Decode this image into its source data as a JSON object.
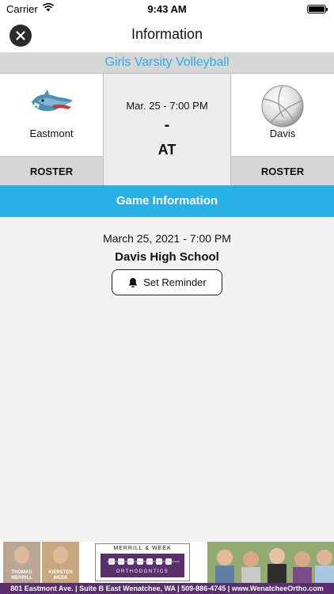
{
  "status_bar": {
    "carrier": "Carrier",
    "time": "9:43 AM"
  },
  "nav": {
    "title": "Information"
  },
  "sport": "Girls Varsity Volleyball",
  "matchup": {
    "home_team": "Eastmont",
    "away_team": "Davis",
    "datetime": "Mar. 25 - 7:00 PM",
    "score": "-",
    "at_label": "AT",
    "roster_label": "ROSTER"
  },
  "game_info": {
    "header": "Game Information",
    "datetime": "March 25, 2021 - 7:00 PM",
    "location": "Davis High School",
    "reminder_label": "Set Reminder"
  },
  "ad": {
    "person1": "THOMAS\nMERRILL",
    "person2": "KIERSTEN\nWEEK",
    "brand_top": "MERRILL & WEEK",
    "brand_bottom": "ORTHODONTICS",
    "footer": "801 Eastmont Ave. | Suite B East Wenatchee, WA | 509-886-4745 | www.WenatcheeOrtho.com"
  },
  "colors": {
    "accent": "#29b1e6",
    "brand_purple": "#5b2f6e"
  },
  "icons": {
    "close": "close-icon",
    "bell": "bell-icon",
    "wifi": "wifi-icon",
    "battery": "battery-icon"
  }
}
